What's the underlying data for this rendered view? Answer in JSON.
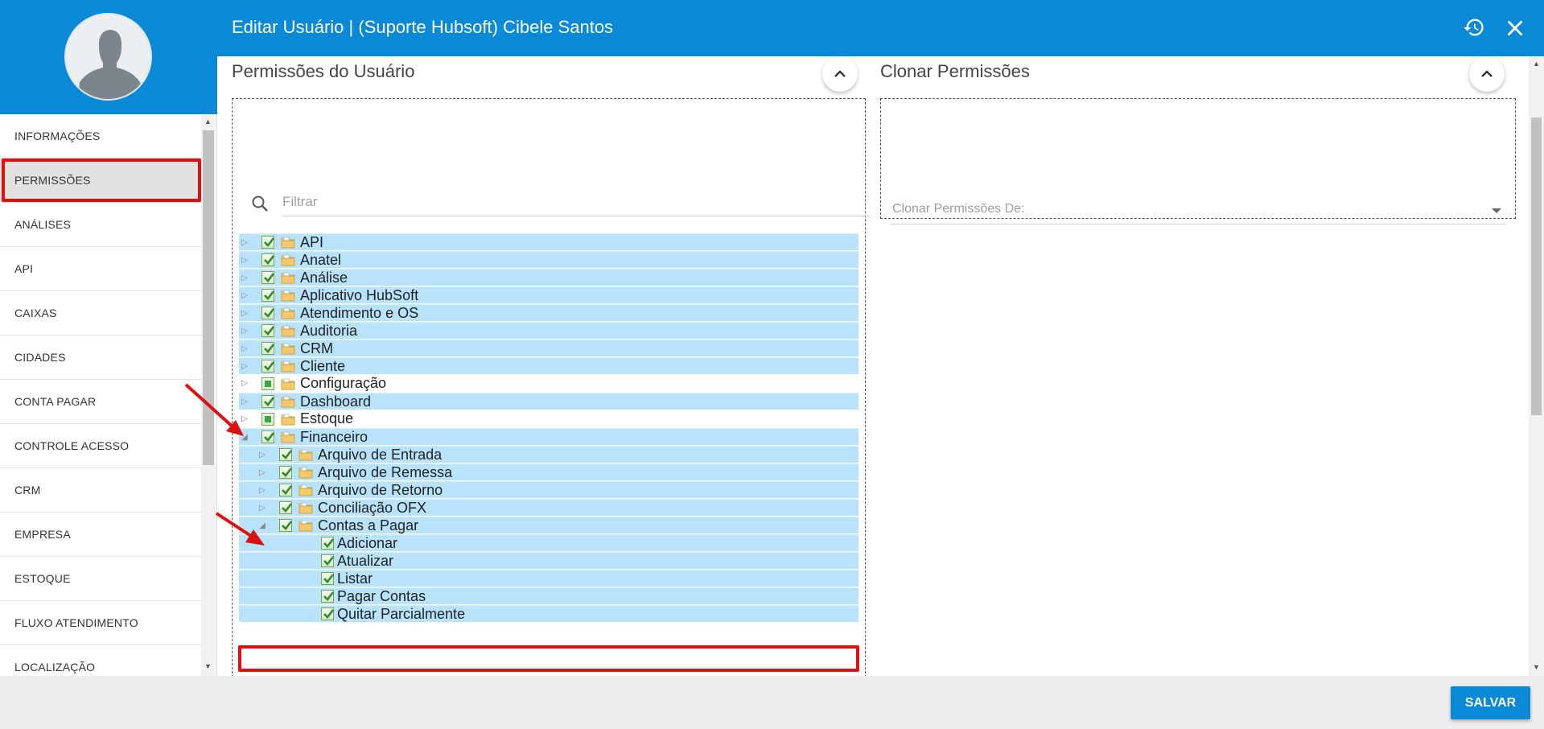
{
  "header": {
    "title": "Editar Usuário | (Suporte Hubsoft) Cibele Santos",
    "history_icon": "history-icon",
    "close_icon": "close-icon"
  },
  "sidebar": {
    "items": [
      {
        "label": "INFORMAÇÕES",
        "active": false
      },
      {
        "label": "PERMISSÕES",
        "active": true
      },
      {
        "label": "ANÁLISES",
        "active": false
      },
      {
        "label": "API",
        "active": false
      },
      {
        "label": "CAIXAS",
        "active": false
      },
      {
        "label": "CIDADES",
        "active": false
      },
      {
        "label": "CONTA PAGAR",
        "active": false
      },
      {
        "label": "CONTROLE ACESSO",
        "active": false
      },
      {
        "label": "CRM",
        "active": false
      },
      {
        "label": "EMPRESA",
        "active": false
      },
      {
        "label": "ESTOQUE",
        "active": false
      },
      {
        "label": "FLUXO ATENDIMENTO",
        "active": false
      },
      {
        "label": "LOCALIZAÇÃO",
        "active": false
      }
    ]
  },
  "permissions": {
    "title": "Permissões do Usuário",
    "filter_placeholder": "Filtrar",
    "tree": [
      {
        "label": "API",
        "level": 0,
        "expanded": false,
        "checked": "full",
        "selected": true,
        "leaf": false
      },
      {
        "label": "Anatel",
        "level": 0,
        "expanded": false,
        "checked": "full",
        "selected": true,
        "leaf": false
      },
      {
        "label": "Análise",
        "level": 0,
        "expanded": false,
        "checked": "full",
        "selected": true,
        "leaf": false
      },
      {
        "label": "Aplicativo HubSoft",
        "level": 0,
        "expanded": false,
        "checked": "full",
        "selected": true,
        "leaf": false
      },
      {
        "label": "Atendimento e OS",
        "level": 0,
        "expanded": false,
        "checked": "full",
        "selected": true,
        "leaf": false
      },
      {
        "label": "Auditoria",
        "level": 0,
        "expanded": false,
        "checked": "full",
        "selected": true,
        "leaf": false
      },
      {
        "label": "CRM",
        "level": 0,
        "expanded": false,
        "checked": "full",
        "selected": true,
        "leaf": false
      },
      {
        "label": "Cliente",
        "level": 0,
        "expanded": false,
        "checked": "full",
        "selected": true,
        "leaf": false
      },
      {
        "label": "Configuração",
        "level": 0,
        "expanded": false,
        "checked": "partial",
        "selected": false,
        "leaf": false
      },
      {
        "label": "Dashboard",
        "level": 0,
        "expanded": false,
        "checked": "full",
        "selected": true,
        "leaf": false
      },
      {
        "label": "Estoque",
        "level": 0,
        "expanded": false,
        "checked": "partial",
        "selected": false,
        "leaf": false
      },
      {
        "label": "Financeiro",
        "level": 0,
        "expanded": true,
        "checked": "full",
        "selected": true,
        "leaf": false
      },
      {
        "label": "Arquivo de Entrada",
        "level": 1,
        "expanded": false,
        "checked": "full",
        "selected": true,
        "leaf": false
      },
      {
        "label": "Arquivo de Remessa",
        "level": 1,
        "expanded": false,
        "checked": "full",
        "selected": true,
        "leaf": false
      },
      {
        "label": "Arquivo de Retorno",
        "level": 1,
        "expanded": false,
        "checked": "full",
        "selected": true,
        "leaf": false
      },
      {
        "label": "Conciliação OFX",
        "level": 1,
        "expanded": false,
        "checked": "full",
        "selected": true,
        "leaf": false
      },
      {
        "label": "Contas a Pagar",
        "level": 1,
        "expanded": true,
        "checked": "full",
        "selected": true,
        "leaf": false
      },
      {
        "label": "Adicionar",
        "level": 2,
        "expanded": false,
        "checked": "full",
        "selected": true,
        "leaf": true
      },
      {
        "label": "Atualizar",
        "level": 2,
        "expanded": false,
        "checked": "full",
        "selected": true,
        "leaf": true
      },
      {
        "label": "Listar",
        "level": 2,
        "expanded": false,
        "checked": "full",
        "selected": true,
        "leaf": true
      },
      {
        "label": "Pagar Contas",
        "level": 2,
        "expanded": false,
        "checked": "full",
        "selected": true,
        "leaf": true
      },
      {
        "label": "Quitar Parcialmente",
        "level": 2,
        "expanded": false,
        "checked": "full",
        "selected": true,
        "leaf": true
      }
    ]
  },
  "clone": {
    "title": "Clonar Permissões",
    "select_label": "Clonar Permissões De:"
  },
  "footer": {
    "save_label": "SALVAR"
  },
  "colors": {
    "brand": "#0a8ad6",
    "selected_row": "#b9e3fa",
    "annotation": "#e01010"
  }
}
